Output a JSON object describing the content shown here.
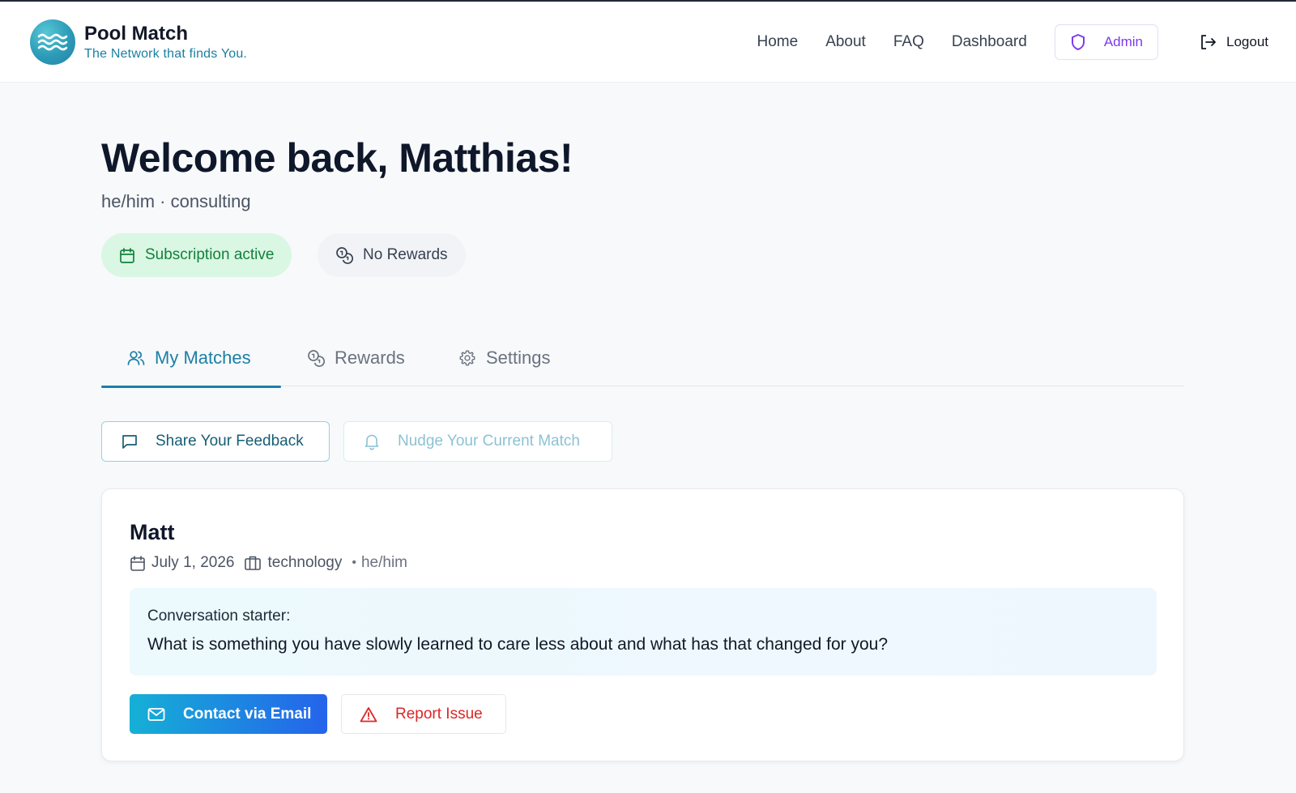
{
  "brand": {
    "name": "Pool Match",
    "tagline": "The Network that finds You."
  },
  "nav": {
    "home": "Home",
    "about": "About",
    "faq": "FAQ",
    "dashboard": "Dashboard",
    "admin": "Admin",
    "logout": "Logout"
  },
  "welcome": {
    "title": "Welcome back, Matthias!",
    "subtitle": "he/him · consulting",
    "subscription_status": "Subscription active",
    "rewards_status": "No Rewards"
  },
  "tabs": [
    {
      "label": "My Matches",
      "active": true
    },
    {
      "label": "Rewards",
      "active": false
    },
    {
      "label": "Settings",
      "active": false
    }
  ],
  "actions": {
    "feedback": "Share Your Feedback",
    "nudge": "Nudge Your Current Match"
  },
  "match": {
    "name": "Matt",
    "date": "July 1, 2026",
    "industry": "technology",
    "pronouns": "he/him",
    "starter_label": "Conversation starter:",
    "starter_question": "What is something you have slowly learned to care less about and what has that changed for you?",
    "contact_button": "Contact via Email",
    "report_button": "Report Issue"
  },
  "colors": {
    "accent": "#1c7fa6",
    "admin": "#7c3aed",
    "success": "#15803d",
    "danger": "#dc2626",
    "primary_gradient_start": "#15b0d6",
    "primary_gradient_end": "#2563eb"
  },
  "icons": {
    "logo": "waves-logo",
    "admin": "shield-icon",
    "logout": "logout-icon",
    "subscription": "calendar-icon",
    "rewards": "coins-icon",
    "matches_tab": "users-icon",
    "settings_tab": "gear-icon",
    "feedback": "message-icon",
    "nudge": "bell-icon",
    "email": "mail-icon",
    "report": "warning-icon",
    "industry": "briefcase-icon"
  }
}
